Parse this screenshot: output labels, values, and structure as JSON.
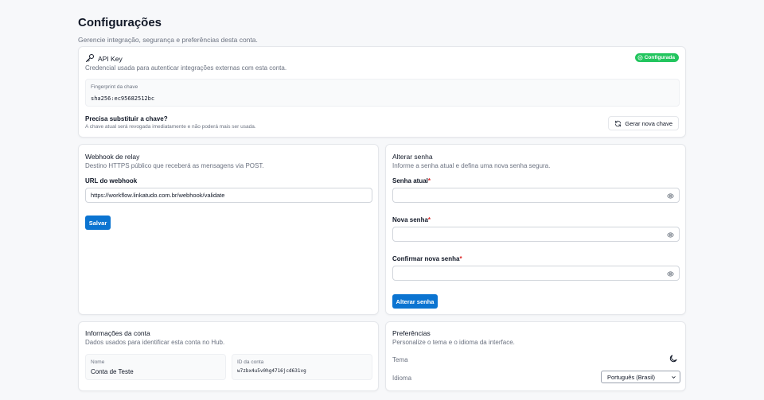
{
  "header": {
    "title": "Configurações",
    "subtitle": "Gerencie integração, segurança e preferências desta conta."
  },
  "api_key": {
    "title": "API Key",
    "description": "Credencial usada para autenticar integrações externas com esta conta.",
    "status_badge": "Configurada",
    "fingerprint_label": "Fingerprint da chave",
    "fingerprint_value": "sha256:ec95682512bc",
    "replace_title": "Precisa substituir a chave?",
    "replace_desc": "A chave atual será revogada imediatamente e não poderá mais ser usada.",
    "regenerate_button": "Gerar nova chave"
  },
  "webhook": {
    "title": "Webhook de relay",
    "description": "Destino HTTPS público que receberá as mensagens via POST.",
    "url_label": "URL do webhook",
    "url_value": "https://workflow.linkatudo.com.br/webhook/validate",
    "save_button": "Salvar"
  },
  "password": {
    "title": "Alterar senha",
    "description": "Informe a senha atual e defina uma nova senha segura.",
    "current_label": "Senha atual",
    "new_label": "Nova senha",
    "confirm_label": "Confirmar nova senha",
    "required_mark": "*",
    "submit_button": "Alterar senha"
  },
  "account": {
    "title": "Informações da conta",
    "description": "Dados usados para identificar esta conta no Hub.",
    "name_label": "Nome",
    "name_value": "Conta de Teste",
    "id_label": "ID da conta",
    "id_value": "w7zbx4u5v0hg4716jcd631vg"
  },
  "preferences": {
    "title": "Preferências",
    "description": "Personalize o tema e o idioma da interface.",
    "theme_label": "Tema",
    "language_label": "Idioma",
    "language_value": "Português (Brasil)"
  },
  "colors": {
    "accent": "#0b74d1",
    "success": "#22c55e",
    "required": "#dc2626"
  }
}
